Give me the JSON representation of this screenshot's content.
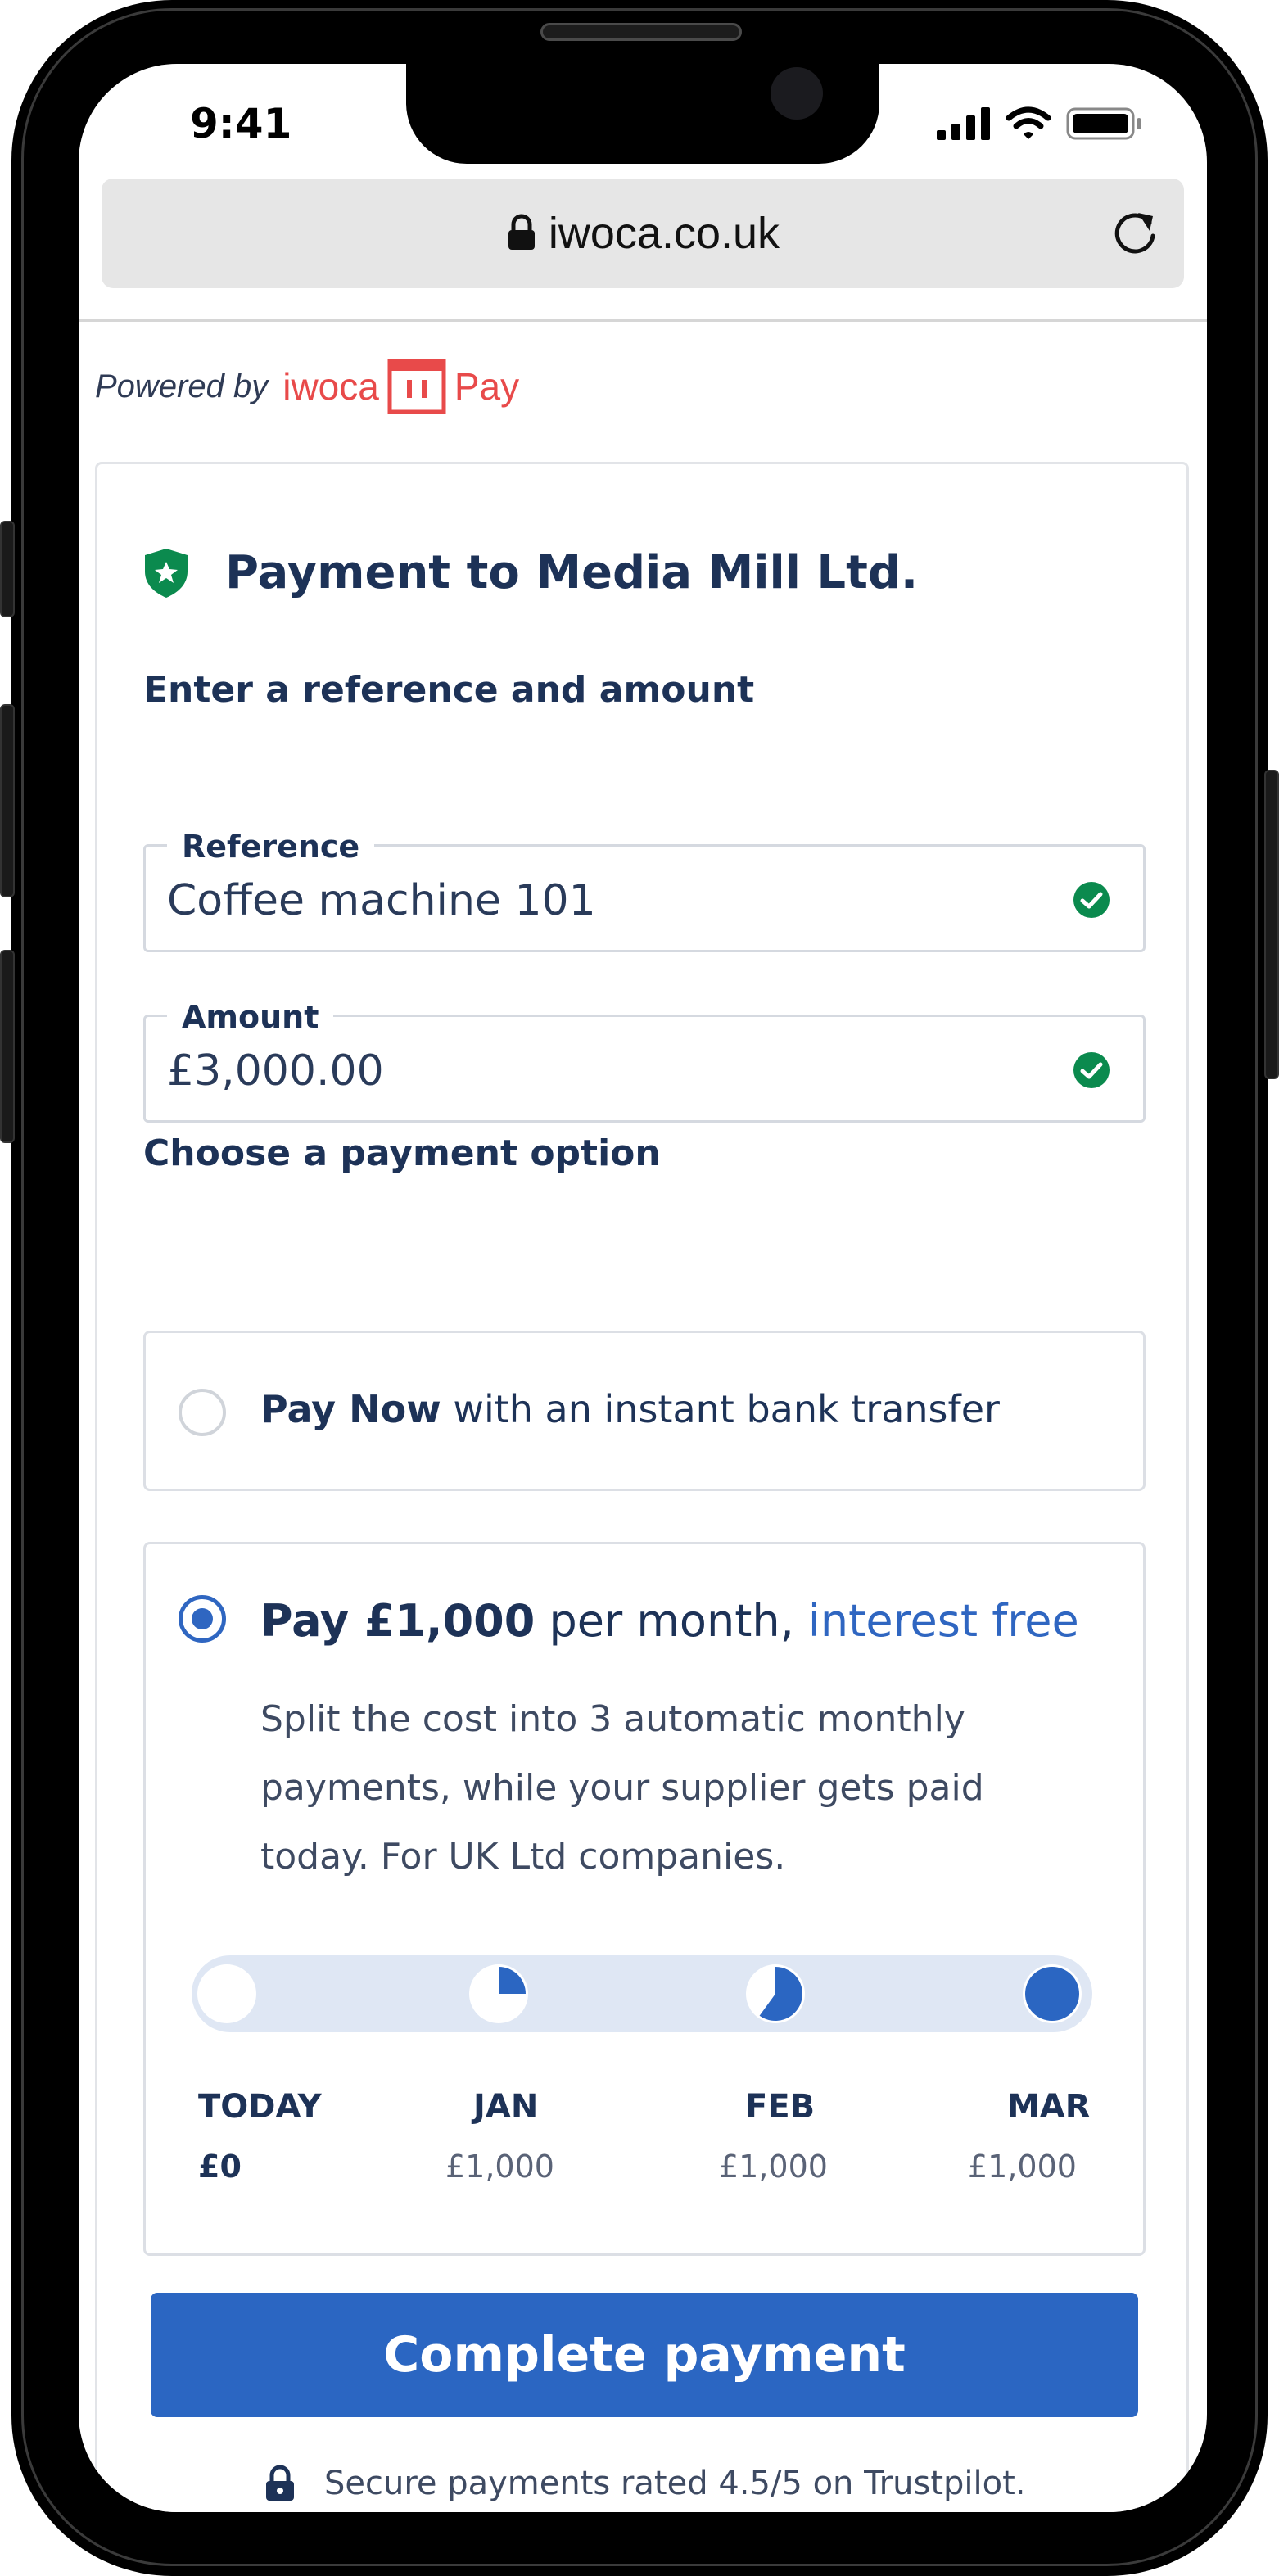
{
  "status_bar": {
    "time": "9:41"
  },
  "browser": {
    "url": "iwoca.co.uk"
  },
  "branding": {
    "powered_by": "Powered by",
    "brand_name": "iwoca",
    "product": "Pay"
  },
  "payment": {
    "title": "Payment to Media Mill Ltd.",
    "reference_section": "Enter a reference and amount",
    "fields": {
      "reference": {
        "label": "Reference",
        "value": "Coffee machine 101"
      },
      "amount": {
        "label": "Amount",
        "value": "£3,000.00"
      }
    },
    "options_section": "Choose a payment option",
    "options": {
      "pay_now": {
        "bold": "Pay Now",
        "rest": " with an instant bank transfer",
        "selected": false
      },
      "pay_monthly": {
        "bold": "Pay £1,000",
        "middle": " per month, ",
        "accent": "interest free",
        "description": "Split the cost into 3 automatic monthly payments, while your supplier gets paid today.  For UK Ltd companies.",
        "selected": true
      }
    },
    "schedule": [
      {
        "label": "TODAY",
        "amount": "£0",
        "paid_fraction": 0
      },
      {
        "label": "JAN",
        "amount": "£1,000",
        "paid_fraction": 0.25
      },
      {
        "label": "FEB",
        "amount": "£1,000",
        "paid_fraction": 0.6
      },
      {
        "label": "MAR",
        "amount": "£1,000",
        "paid_fraction": 1
      }
    ],
    "cta_label": "Complete payment",
    "security_note": "Secure payments rated 4.5/5 on Trustpilot."
  },
  "colors": {
    "accent": "#2f66c1",
    "brand": "#e84a4a",
    "success": "#0b8a4e",
    "navy": "#1d3257"
  },
  "icons": [
    "lock-icon",
    "reload-icon",
    "shield-star-icon",
    "check-circle-icon",
    "signal-icon",
    "wifi-icon",
    "battery-icon"
  ]
}
